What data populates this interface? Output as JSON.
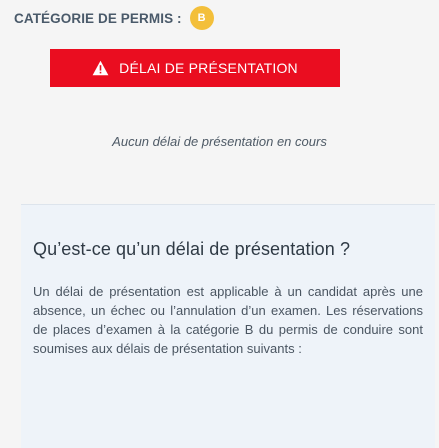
{
  "permis": {
    "label": "CATÉGORIE DE PERMIS :",
    "category": "B",
    "badge_color": "#f3bf3a"
  },
  "action": {
    "icon": "warning-triangle-icon",
    "label": "DÉLAI DE PRÉSENTATION",
    "color": "#ea0d20"
  },
  "empty_state": {
    "text": "Aucun délai de présentation en cours"
  },
  "info": {
    "title": "Qu’est-ce qu’un délai de présentation ?",
    "body": "Un délai de présentation est applicable à un candidat après une absence, un échec ou l’annulation d’un examen. Les réservations de places d’examen à la catégorie B du permis de conduire sont soumises aux délais de présentation suivants :"
  }
}
